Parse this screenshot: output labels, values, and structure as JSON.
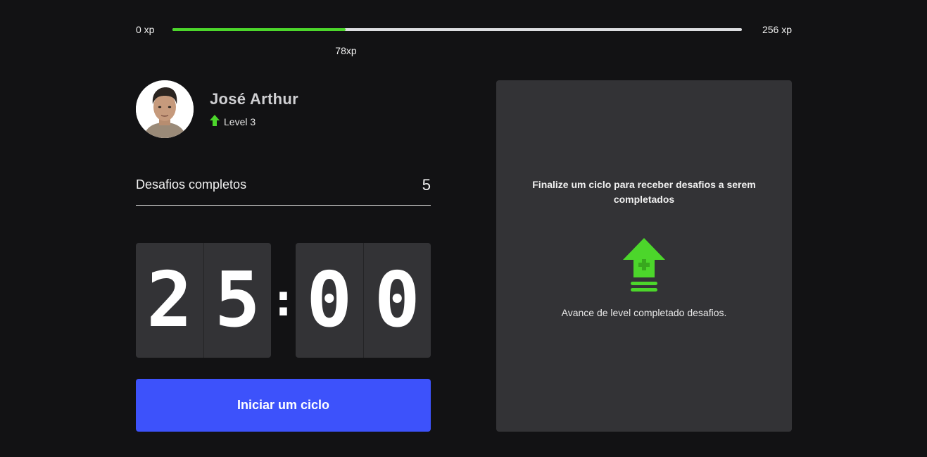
{
  "xp": {
    "min_label": "0 xp",
    "max_label": "256 xp",
    "current_label": "78xp",
    "current": 78,
    "max": 256
  },
  "profile": {
    "name": "José Arthur",
    "level_label": "Level 3",
    "avatar_icon": "user-photo"
  },
  "challenges": {
    "completed_label": "Desafios completos",
    "completed_count": "5"
  },
  "countdown": {
    "minutes_left": "2",
    "minutes_right": "5",
    "separator": ":",
    "seconds_left": "0",
    "seconds_right": "0"
  },
  "actions": {
    "start_cycle_label": "Iniciar um ciclo"
  },
  "challenge_box": {
    "title": "Finalize um ciclo para receber desafios a serem completados",
    "note": "Avance de level completado desafios.",
    "icon": "level-up-icon"
  },
  "colors": {
    "background": "#121214",
    "accent_green": "#4cd62b",
    "button_blue": "#3d52fb",
    "panel": "#333336"
  }
}
